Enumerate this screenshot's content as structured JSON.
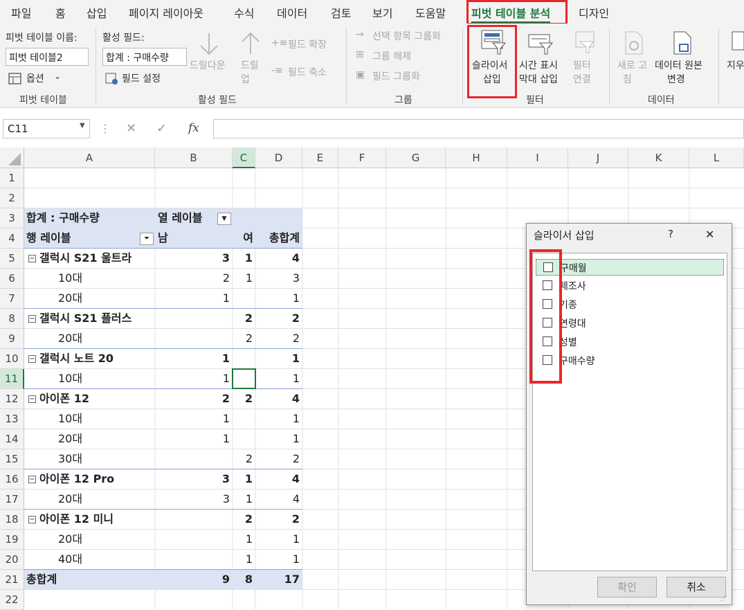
{
  "tabs": [
    "파일",
    "홈",
    "삽입",
    "페이지 레이아웃",
    "수식",
    "데이터",
    "검토",
    "보기",
    "도움말",
    "피벗 테이블 분석",
    "디자인"
  ],
  "ribbon": {
    "pivot_name_label": "피벗 테이블 이름:",
    "pivot_name_value": "피벗 테이블2",
    "options": "옵션",
    "group_pivot": "피벗 테이블",
    "active_field_label": "활성 필드:",
    "active_field_value": "합계 : 구매수량",
    "field_settings": "필드 설정",
    "drill_down": "드릴다운",
    "drill_up_1": "드릴",
    "drill_up_2": "업",
    "expand_field": "필드 확장",
    "collapse_field": "필드 축소",
    "group_active": "활성 필드",
    "group_selection": "선택 항목 그룹화",
    "ungroup": "그룹 해제",
    "group_field": "필드 그룹화",
    "group_group": "그룹",
    "slicer_1": "슬라이서",
    "slicer_2": "삽입",
    "timeline_1": "시간 표시",
    "timeline_2": "막대 삽입",
    "filter_conn_1": "필터",
    "filter_conn_2": "연결",
    "group_filter": "필터",
    "refresh_1": "새로 고",
    "refresh_2": "침",
    "change_source_1": "데이터 원본",
    "change_source_2": "변경",
    "group_data": "데이터",
    "clear": "지우"
  },
  "formula": {
    "namebox": "C11",
    "cancel": "✕",
    "enter": "✓",
    "fx": "fx",
    "value": ""
  },
  "columns": [
    "A",
    "B",
    "C",
    "D",
    "E",
    "F",
    "G",
    "H",
    "I",
    "J",
    "K",
    "L"
  ],
  "rows": [
    "1",
    "2",
    "3",
    "4",
    "5",
    "6",
    "7",
    "8",
    "9",
    "10",
    "11",
    "12",
    "13",
    "14",
    "15",
    "16",
    "17",
    "18",
    "19",
    "20",
    "21",
    "22"
  ],
  "pivot": {
    "r3a": "합계 : 구매수량",
    "r3b": "열 레이블",
    "r4a": "행 레이블",
    "r4b": "남",
    "r4c": "여",
    "r4d": "총합계",
    "body": [
      {
        "a": "갤럭시 S21 울트라",
        "b": "3",
        "c": "1",
        "d": "4",
        "bold": true
      },
      {
        "a": "10대",
        "b": "2",
        "c": "1",
        "d": "3"
      },
      {
        "a": "20대",
        "b": "1",
        "c": "",
        "d": "1"
      },
      {
        "a": "갤럭시 S21 플러스",
        "b": "",
        "c": "2",
        "d": "2",
        "bold": true
      },
      {
        "a": "20대",
        "b": "",
        "c": "2",
        "d": "2"
      },
      {
        "a": "갤럭시 노트 20",
        "b": "1",
        "c": "",
        "d": "1",
        "bold": true
      },
      {
        "a": "10대",
        "b": "1",
        "c": "",
        "d": "1"
      },
      {
        "a": "아이폰 12",
        "b": "2",
        "c": "2",
        "d": "4",
        "bold": true
      },
      {
        "a": "10대",
        "b": "1",
        "c": "",
        "d": "1"
      },
      {
        "a": "20대",
        "b": "1",
        "c": "",
        "d": "1"
      },
      {
        "a": "30대",
        "b": "",
        "c": "2",
        "d": "2"
      },
      {
        "a": "아이폰 12 Pro",
        "b": "3",
        "c": "1",
        "d": "4",
        "bold": true
      },
      {
        "a": "20대",
        "b": "3",
        "c": "1",
        "d": "4"
      },
      {
        "a": "아이폰 12 미니",
        "b": "",
        "c": "2",
        "d": "2",
        "bold": true
      },
      {
        "a": "20대",
        "b": "",
        "c": "1",
        "d": "1"
      },
      {
        "a": "40대",
        "b": "",
        "c": "1",
        "d": "1"
      }
    ],
    "total": {
      "a": "총합계",
      "b": "9",
      "c": "8",
      "d": "17"
    }
  },
  "dialog": {
    "title": "슬라이서 삽입",
    "help": "?",
    "close": "✕",
    "fields": [
      "구매월",
      "제조사",
      "기종",
      "연령대",
      "성별",
      "구매수량"
    ],
    "ok": "확인",
    "cancel": "취소"
  },
  "colors": {
    "accent": "#1b7a3e",
    "highlight": "#e8262a",
    "pivot_header": "#dce3f2"
  }
}
